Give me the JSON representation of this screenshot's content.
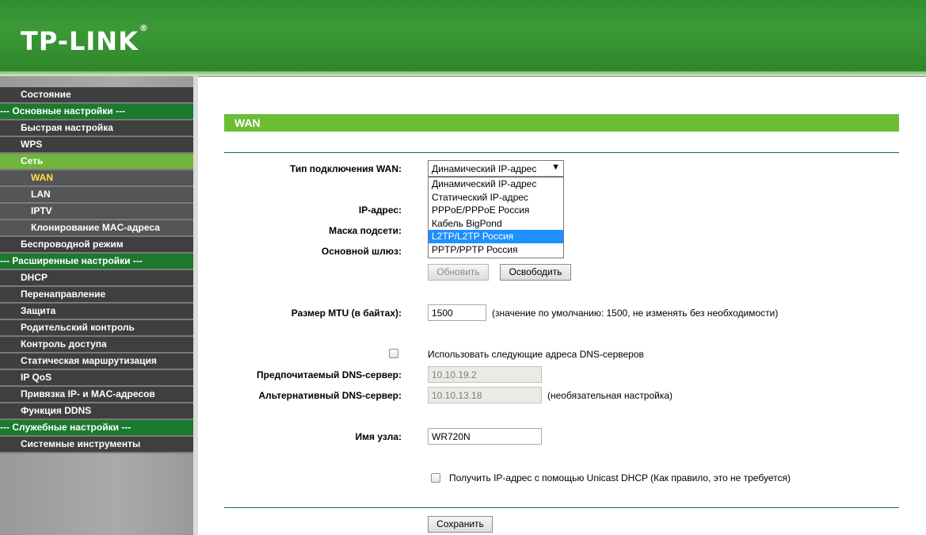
{
  "header": {
    "brand": "TP-LINK",
    "trademark": "®"
  },
  "sidebar": {
    "items": [
      {
        "label": "Состояние",
        "kind": "item"
      },
      {
        "label": "--- Основные настройки ---",
        "kind": "section"
      },
      {
        "label": "Быстрая настройка",
        "kind": "item"
      },
      {
        "label": "WPS",
        "kind": "item"
      },
      {
        "label": "Сеть",
        "kind": "active"
      },
      {
        "label": "WAN",
        "kind": "sub-selected"
      },
      {
        "label": "LAN",
        "kind": "sub"
      },
      {
        "label": "IPTV",
        "kind": "sub"
      },
      {
        "label": "Клонирование MAC-адреса",
        "kind": "sub"
      },
      {
        "label": "Беспроводной режим",
        "kind": "item"
      },
      {
        "label": "--- Расширенные настройки ---",
        "kind": "section"
      },
      {
        "label": "DHCP",
        "kind": "item"
      },
      {
        "label": "Перенаправление",
        "kind": "item"
      },
      {
        "label": "Защита",
        "kind": "item"
      },
      {
        "label": "Родительский контроль",
        "kind": "item"
      },
      {
        "label": "Контроль доступа",
        "kind": "item"
      },
      {
        "label": "Статическая маршрутизация",
        "kind": "item"
      },
      {
        "label": "IP QoS",
        "kind": "item"
      },
      {
        "label": "Привязка IP- и MAC-адресов",
        "kind": "item"
      },
      {
        "label": "Функция DDNS",
        "kind": "item"
      },
      {
        "label": "--- Служебные настройки ---",
        "kind": "section"
      },
      {
        "label": "Системные инструменты",
        "kind": "item"
      }
    ]
  },
  "main": {
    "title": "WAN",
    "wan_type": {
      "label": "Тип подключения WAN:",
      "selected": "Динамический IP-адрес",
      "arrow": "▼",
      "options": [
        "Динамический IP-адрес",
        "Статический IP-адрес",
        "PPPoE/PPPoE Россия",
        "Кабель BigPond",
        "L2TP/L2TP Россия",
        "PPTP/PPTP Россия"
      ],
      "highlighted": "L2TP/L2TP Россия"
    },
    "ip_label": "IP-адрес:",
    "mask_label": "Маска подсети:",
    "gateway_label": "Основной шлюз:",
    "renew_button": "Обновить",
    "release_button": "Освободить",
    "mtu": {
      "label": "Размер MTU (в байтах):",
      "value": "1500",
      "hint": "(значение по умолчанию: 1500, не изменять без необходимости)"
    },
    "dns_manual": {
      "label": "Использовать следующие адреса DNS-серверов",
      "checked": false
    },
    "dns_primary": {
      "label": "Предпочитаемый DNS-сервер:",
      "value": "10.10.19.2"
    },
    "dns_secondary": {
      "label": "Альтернативный DNS-сервер:",
      "value": "10.10.13.18",
      "hint": "(необязательная настройка)"
    },
    "hostname": {
      "label": "Имя узла:",
      "value": "WR720N"
    },
    "unicast": {
      "label": "Получить IP-адрес с помощью Unicast DHCP (Как правило, это не требуется)",
      "checked": false
    },
    "save_button": "Сохранить"
  }
}
